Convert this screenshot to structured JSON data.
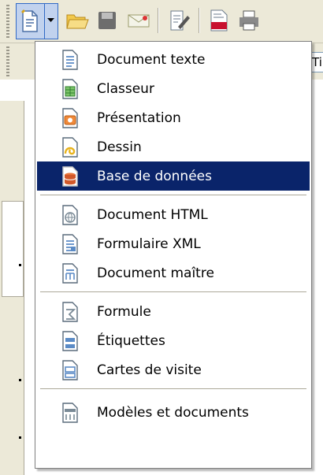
{
  "menu": {
    "items": [
      {
        "label": "Document texte",
        "icon": "writer-document-icon",
        "color": "#5b8bc6"
      },
      {
        "label": "Classeur",
        "icon": "calc-spreadsheet-icon",
        "color": "#3fa63f"
      },
      {
        "label": "Présentation",
        "icon": "impress-presentation-icon",
        "color": "#e0701e"
      },
      {
        "label": "Dessin",
        "icon": "draw-drawing-icon",
        "color": "#e8b31d"
      },
      {
        "label": "Base de données",
        "icon": "base-database-icon",
        "color": "#d2582a",
        "selected": true
      },
      {
        "label": "Document HTML",
        "icon": "html-document-icon",
        "color": "#7a8a96"
      },
      {
        "label": "Formulaire XML",
        "icon": "xml-form-icon",
        "color": "#5b8bc6"
      },
      {
        "label": "Document maître",
        "icon": "master-document-icon",
        "color": "#5b8bc6"
      },
      {
        "label": "Formule",
        "icon": "math-formula-icon",
        "color": "#7a8a96"
      },
      {
        "label": "Étiquettes",
        "icon": "labels-icon",
        "color": "#5b8bc6"
      },
      {
        "label": "Cartes de visite",
        "icon": "business-cards-icon",
        "color": "#5b8bc6"
      },
      {
        "label": "Modèles et documents",
        "icon": "templates-icon",
        "color": "#7a8a96"
      }
    ]
  },
  "toolbar": {
    "icons": [
      "new-document-icon",
      "dropdown-arrow-icon",
      "open-folder-icon",
      "save-icon",
      "email-icon",
      "edit-file-icon",
      "export-pdf-icon",
      "print-icon"
    ],
    "partial_text": "Ti"
  },
  "colors": {
    "selection": "#0a246a",
    "chrome": "#ece9d8"
  }
}
